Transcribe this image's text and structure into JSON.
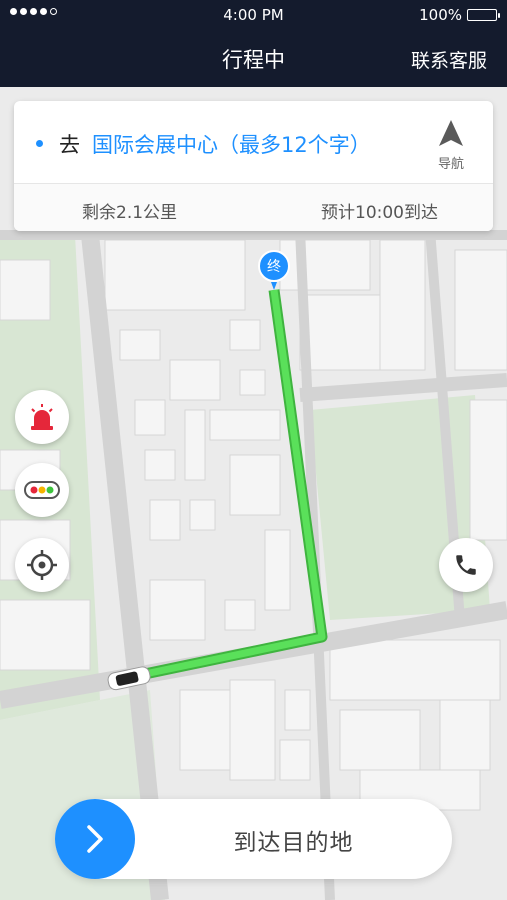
{
  "status_bar": {
    "time": "4:00 PM",
    "battery": "100%"
  },
  "nav": {
    "title": "行程中",
    "right_action": "联系客服"
  },
  "destination_card": {
    "prefix": "去",
    "destination": "国际会展中心（最多12个字）",
    "nav_label": "导航",
    "remaining_distance": "剩余2.1公里",
    "eta": "预计10:00到达"
  },
  "map": {
    "end_marker_label": "终"
  },
  "slider": {
    "label": "到达目的地"
  },
  "colors": {
    "accent": "#1e90ff",
    "route": "#4cd44c",
    "topbar": "#141b2d"
  },
  "icons": [
    "alarm-light-icon",
    "traffic-light-icon",
    "locate-icon",
    "phone-icon",
    "navigation-arrow-icon",
    "chevron-right-icon",
    "car-icon"
  ]
}
